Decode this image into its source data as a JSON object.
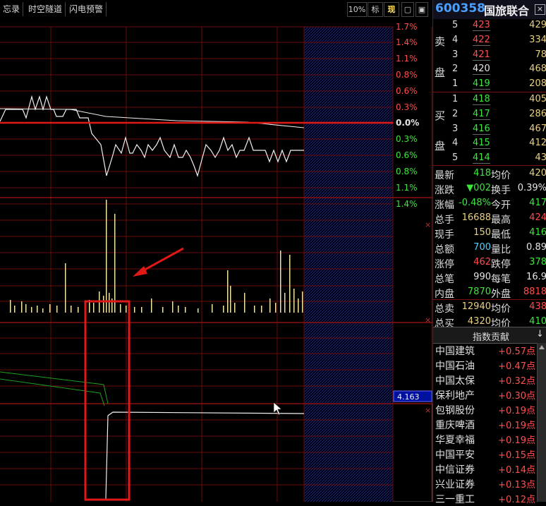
{
  "toolbar": {
    "items": [
      "忘录",
      "时空隧道",
      "闪电预警"
    ],
    "zoom": "10%",
    "mark": "标",
    "now": "现"
  },
  "stock": {
    "code": "600358",
    "name": "国旅联合"
  },
  "pct_axis": [
    "1.7%",
    "1.4%",
    "1.1%",
    "0.8%",
    "0.6%",
    "0.3%",
    "0.0%",
    "0.3%",
    "0.6%",
    "0.8%",
    "1.1%",
    "1.4%"
  ],
  "indicator_value": "4.163",
  "orderbook": {
    "sell_label": [
      "卖",
      "盘"
    ],
    "buy_label": [
      "买",
      "盘"
    ],
    "sell": [
      {
        "level": "5",
        "price": "423",
        "vol": "429"
      },
      {
        "level": "4",
        "price": "422",
        "vol": "334"
      },
      {
        "level": "3",
        "price": "421",
        "vol": "78"
      },
      {
        "level": "2",
        "price": "420",
        "vol": "468"
      },
      {
        "level": "1",
        "price": "419",
        "vol": "208"
      }
    ],
    "buy": [
      {
        "level": "1",
        "price": "418",
        "vol": "405"
      },
      {
        "level": "2",
        "price": "417",
        "vol": "286"
      },
      {
        "level": "3",
        "price": "416",
        "vol": "467"
      },
      {
        "level": "4",
        "price": "415",
        "vol": "412"
      },
      {
        "level": "5",
        "price": "414",
        "vol": "43"
      }
    ]
  },
  "quote": [
    {
      "l1": "最新",
      "v1": "418",
      "c1": "green",
      "l2": "均价",
      "v2": "420",
      "c2": "yellow"
    },
    {
      "l1": "涨跌",
      "v1": "▼002",
      "c1": "green",
      "l2": "换手",
      "v2": "0.39%",
      "c2": "white"
    },
    {
      "l1": "涨幅",
      "v1": "-0.48%",
      "c1": "green",
      "l2": "今开",
      "v2": "417",
      "c2": "green"
    },
    {
      "l1": "总手",
      "v1": "16688",
      "c1": "yellow",
      "l2": "最高",
      "v2": "424",
      "c2": "red"
    },
    {
      "l1": "现手",
      "v1": "150",
      "c1": "yellow",
      "l2": "最低",
      "v2": "416",
      "c2": "green"
    },
    {
      "l1": "总额",
      "v1": "700",
      "c1": "cyan",
      "l2": "量比",
      "v2": "0.89",
      "c2": "white"
    },
    {
      "l1": "涨停",
      "v1": "462",
      "c1": "red",
      "l2": "跌停",
      "v2": "378",
      "c2": "green"
    },
    {
      "l1": "总笔",
      "v1": "990",
      "c1": "white",
      "l2": "每笔",
      "v2": "16.9",
      "c2": "white"
    },
    {
      "l1": "内盘",
      "v1": "7870",
      "c1": "green",
      "l2": "外盘",
      "v2": "8818",
      "c2": "red"
    }
  ],
  "totals": [
    {
      "l1": "总卖",
      "v1": "12940",
      "c1": "yellow",
      "l2": "均价",
      "v2": "438",
      "c2": "red"
    },
    {
      "l1": "总买",
      "v1": "4320",
      "c1": "yellow",
      "l2": "均价",
      "v2": "410",
      "c2": "green"
    }
  ],
  "contrib": {
    "title": "指数贡献",
    "items": [
      {
        "name": "中国建筑",
        "val": "+0.57点"
      },
      {
        "name": "中国石油",
        "val": "+0.47点"
      },
      {
        "name": "中国太保",
        "val": "+0.32点"
      },
      {
        "name": "保利地产",
        "val": "+0.30点"
      },
      {
        "name": "包钢股份",
        "val": "+0.19点"
      },
      {
        "name": "重庆啤酒",
        "val": "+0.19点"
      },
      {
        "name": "华夏幸福",
        "val": "+0.19点"
      },
      {
        "name": "中国平安",
        "val": "+0.15点"
      },
      {
        "name": "中信证券",
        "val": "+0.14点"
      },
      {
        "name": "兴业证券",
        "val": "+0.13点"
      },
      {
        "name": "三一重工",
        "val": "+0.12点"
      }
    ]
  }
}
